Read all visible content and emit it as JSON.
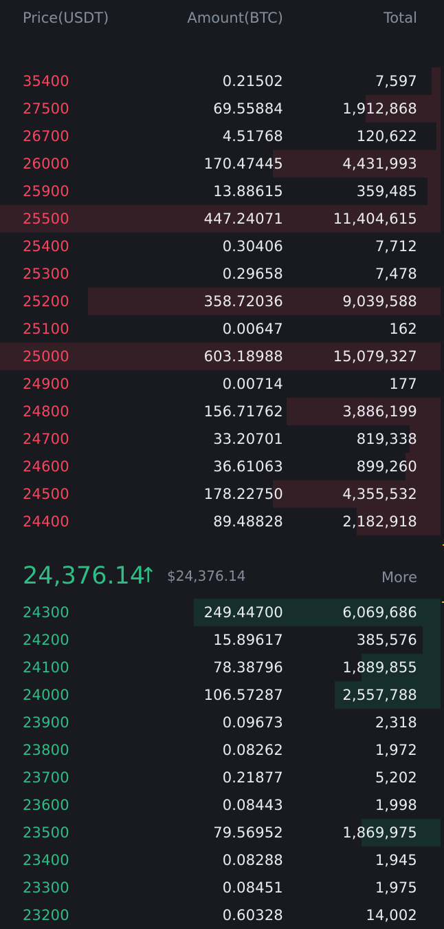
{
  "header": {
    "price_label": "Price(USDT)",
    "amount_label": "Amount(BTC)",
    "total_label": "Total"
  },
  "asks": [
    {
      "price": "35400",
      "amount": "0.21502",
      "total": "7,597",
      "depth": 0.02
    },
    {
      "price": "27500",
      "amount": "69.55884",
      "total": "1,912,868",
      "depth": 0.17
    },
    {
      "price": "26700",
      "amount": "4.51768",
      "total": "120,622",
      "depth": 0.01
    },
    {
      "price": "26000",
      "amount": "170.47445",
      "total": "4,431,993",
      "depth": 0.38
    },
    {
      "price": "25900",
      "amount": "13.88615",
      "total": "359,485",
      "depth": 0.03
    },
    {
      "price": "25500",
      "amount": "447.24071",
      "total": "11,404,615",
      "depth": 1.0
    },
    {
      "price": "25400",
      "amount": "0.30406",
      "total": "7,712",
      "depth": 0.0
    },
    {
      "price": "25300",
      "amount": "0.29658",
      "total": "7,478",
      "depth": 0.0
    },
    {
      "price": "25200",
      "amount": "358.72036",
      "total": "9,039,588",
      "depth": 0.8
    },
    {
      "price": "25100",
      "amount": "0.00647",
      "total": "162",
      "depth": 0.0
    },
    {
      "price": "25000",
      "amount": "603.18988",
      "total": "15,079,327",
      "depth": 1.0
    },
    {
      "price": "24900",
      "amount": "0.00714",
      "total": "177",
      "depth": 0.0
    },
    {
      "price": "24800",
      "amount": "156.71762",
      "total": "3,886,199",
      "depth": 0.35
    },
    {
      "price": "24700",
      "amount": "33.20701",
      "total": "819,338",
      "depth": 0.07
    },
    {
      "price": "24600",
      "amount": "36.61063",
      "total": "899,260",
      "depth": 0.08
    },
    {
      "price": "24500",
      "amount": "178.22750",
      "total": "4,355,532",
      "depth": 0.38
    },
    {
      "price": "24400",
      "amount": "89.48828",
      "total": "2,182,918",
      "depth": 0.19
    }
  ],
  "ticker": {
    "last_price": "24,376.14",
    "arrow": "↑",
    "fiat_price": "$24,376.14",
    "more_label": "More"
  },
  "bids": [
    {
      "price": "24300",
      "amount": "249.44700",
      "total": "6,069,686",
      "depth": 0.56
    },
    {
      "price": "24200",
      "amount": "15.89617",
      "total": "385,576",
      "depth": 0.04
    },
    {
      "price": "24100",
      "amount": "78.38796",
      "total": "1,889,855",
      "depth": 0.18
    },
    {
      "price": "24000",
      "amount": "106.57287",
      "total": "2,557,788",
      "depth": 0.24
    },
    {
      "price": "23900",
      "amount": "0.09673",
      "total": "2,318",
      "depth": 0.0
    },
    {
      "price": "23800",
      "amount": "0.08262",
      "total": "1,972",
      "depth": 0.0
    },
    {
      "price": "23700",
      "amount": "0.21877",
      "total": "5,202",
      "depth": 0.0
    },
    {
      "price": "23600",
      "amount": "0.08443",
      "total": "1,998",
      "depth": 0.0
    },
    {
      "price": "23500",
      "amount": "79.56952",
      "total": "1,869,975",
      "depth": 0.18
    },
    {
      "price": "23400",
      "amount": "0.08288",
      "total": "1,945",
      "depth": 0.0
    },
    {
      "price": "23300",
      "amount": "0.08451",
      "total": "1,975",
      "depth": 0.0
    },
    {
      "price": "23200",
      "amount": "0.60328",
      "total": "14,002",
      "depth": 0.0
    }
  ],
  "colors": {
    "ask": "#f6465d",
    "bid": "#2ebd85",
    "muted": "#848e9c",
    "background": "#181a20"
  }
}
